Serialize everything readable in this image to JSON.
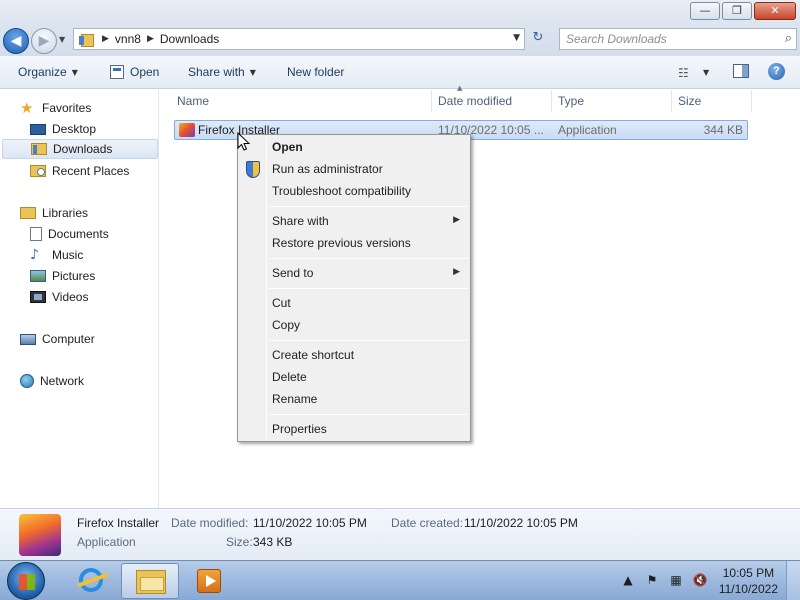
{
  "window": {
    "minimize_glyph": "—",
    "maximize_glyph": "❐",
    "close_glyph": "✕"
  },
  "address": {
    "recent_glyph": "▼",
    "crumbs": [
      "vnn8",
      "Downloads"
    ],
    "separator_glyph": "▶",
    "dropdown_glyph": "▼",
    "refresh_glyph": "↻",
    "search_placeholder": "Search Downloads",
    "search_glyph": "⌕"
  },
  "toolbar": {
    "organize": "Organize",
    "open": "Open",
    "share_with": "Share with",
    "new_folder": "New folder",
    "caret": "▼",
    "view_glyph": "☷",
    "help_glyph": "?"
  },
  "nav": {
    "favorites": "Favorites",
    "desktop": "Desktop",
    "downloads": "Downloads",
    "recent_places": "Recent Places",
    "libraries": "Libraries",
    "documents": "Documents",
    "music": "Music",
    "pictures": "Pictures",
    "videos": "Videos",
    "computer": "Computer",
    "network": "Network",
    "star_glyph": "★",
    "music_glyph": "♪"
  },
  "columns": {
    "name": "Name",
    "date_modified": "Date modified",
    "type": "Type",
    "size": "Size",
    "sort_glyph": "▲"
  },
  "files": [
    {
      "name": "Firefox Installer",
      "date_modified": "11/10/2022 10:05 ...",
      "type": "Application",
      "size": "344 KB"
    }
  ],
  "context_menu": {
    "open": "Open",
    "run_as_admin": "Run as administrator",
    "troubleshoot": "Troubleshoot compatibility",
    "share_with": "Share with",
    "restore_versions": "Restore previous versions",
    "send_to": "Send to",
    "cut": "Cut",
    "copy": "Copy",
    "create_shortcut": "Create shortcut",
    "delete": "Delete",
    "rename": "Rename",
    "properties": "Properties",
    "submenu_arrow": "▶"
  },
  "details": {
    "name": "Firefox Installer",
    "type": "Application",
    "date_modified_label": "Date modified:",
    "date_modified_value": "11/10/2022 10:05 PM",
    "date_created_label": "Date created:",
    "date_created_value": "11/10/2022 10:05 PM",
    "size_label": "Size:",
    "size_value": "343 KB"
  },
  "taskbar": {
    "tray_up_glyph": "▲",
    "tray_flag_glyph": "⚑",
    "tray_network_glyph": "▦",
    "tray_volume_glyph": "🔇",
    "time": "10:05 PM",
    "date": "11/10/2022"
  }
}
